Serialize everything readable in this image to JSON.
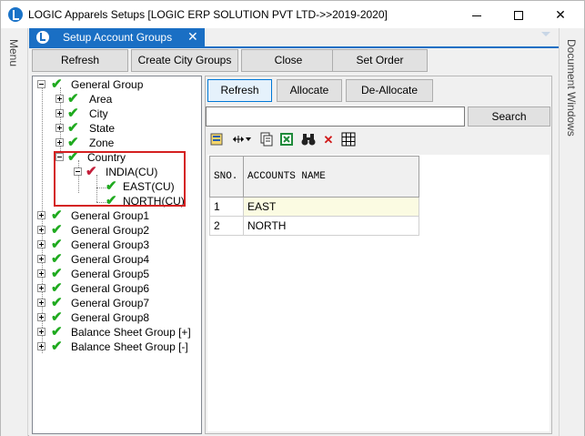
{
  "window": {
    "title": "LOGIC Apparels Setups  [LOGIC ERP SOLUTION PVT LTD->>2019-2020]",
    "accent_color": "#1a6fc4"
  },
  "side": {
    "left_label": "Menu",
    "right_label": "Document Windows"
  },
  "tab": {
    "label": "Setup Account Groups",
    "close": "✕"
  },
  "top_buttons": {
    "refresh": "Refresh",
    "create_city_groups": "Create City Groups",
    "close": "Close",
    "set_order": "Set Order"
  },
  "tree": {
    "root": "General Group",
    "children": [
      "Area",
      "City",
      "State",
      "Zone",
      "Country"
    ],
    "india": "INDIA(CU)",
    "east": "EAST(CU)",
    "north": "NORTH(CU)",
    "groups": [
      "General Group1",
      "General Group2",
      "General Group3",
      "General Group4",
      "General Group5",
      "General Group6",
      "General Group7",
      "General Group8",
      "Balance Sheet Group [+]",
      "Balance Sheet Group [-]"
    ]
  },
  "right_buttons": {
    "refresh": "Refresh",
    "allocate": "Allocate",
    "deallocate": "De-Allocate",
    "search": "Search"
  },
  "search": {
    "value": ""
  },
  "grid": {
    "headers": [
      "SNO.",
      "ACCOUNTS NAME"
    ],
    "rows": [
      {
        "sno": "1",
        "name": "EAST"
      },
      {
        "sno": "2",
        "name": "NORTH"
      }
    ]
  }
}
